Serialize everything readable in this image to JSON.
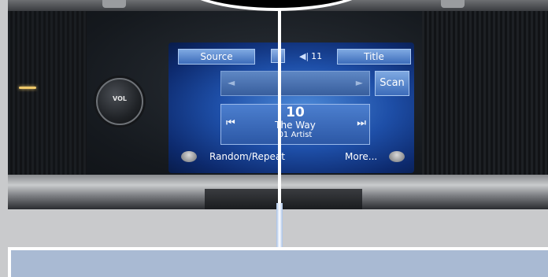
{
  "screen": {
    "source_label": "Source",
    "volume_level": "11",
    "title_label": "Title",
    "seek_left": "◄",
    "seek_right": "►",
    "scan_label": "Scan",
    "track": {
      "prev_symbol": "⏮",
      "next_symbol": "⏭",
      "number": "10",
      "title": "The Way",
      "artist_prefix": "01",
      "artist": "Artist"
    },
    "random_repeat_label": "Random/Repeat",
    "more_label": "More..."
  },
  "dashboard": {
    "knob_label": "VOL"
  },
  "colors": {
    "screen_blue": "#1e4fa8",
    "panel_blue": "#a9bad3",
    "callout_white": "#ffffff"
  }
}
